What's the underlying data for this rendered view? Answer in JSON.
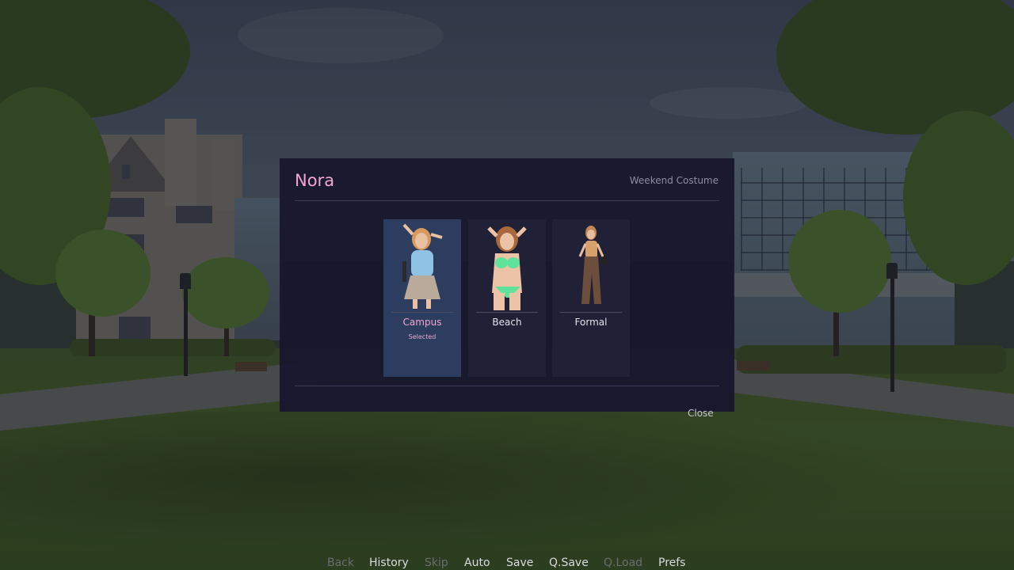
{
  "dialog": {
    "character_name": "Nora",
    "subtitle": "Weekend Costume",
    "close_label": "Close"
  },
  "costumes": [
    {
      "name": "Campus",
      "state": "Selected",
      "selected": true,
      "top_color": "#8fc3e6",
      "bottom_color": "#b9aa9a"
    },
    {
      "name": "Beach",
      "state": "",
      "selected": false,
      "top_color": "#5fe39a",
      "bottom_color": "#5fe39a"
    },
    {
      "name": "Formal",
      "state": "",
      "selected": false,
      "top_color": "#d8a06a",
      "bottom_color": "#6b4e3c"
    }
  ],
  "quick_menu": [
    {
      "label": "Back",
      "enabled": false
    },
    {
      "label": "History",
      "enabled": true
    },
    {
      "label": "Skip",
      "enabled": false
    },
    {
      "label": "Auto",
      "enabled": true
    },
    {
      "label": "Save",
      "enabled": true
    },
    {
      "label": "Q.Save",
      "enabled": true
    },
    {
      "label": "Q.Load",
      "enabled": false
    },
    {
      "label": "Prefs",
      "enabled": true
    }
  ],
  "colors": {
    "accent_pink": "#f3a6cf",
    "dialog_bg": "#17172d",
    "selected_card_bg": "#2d3d60"
  }
}
